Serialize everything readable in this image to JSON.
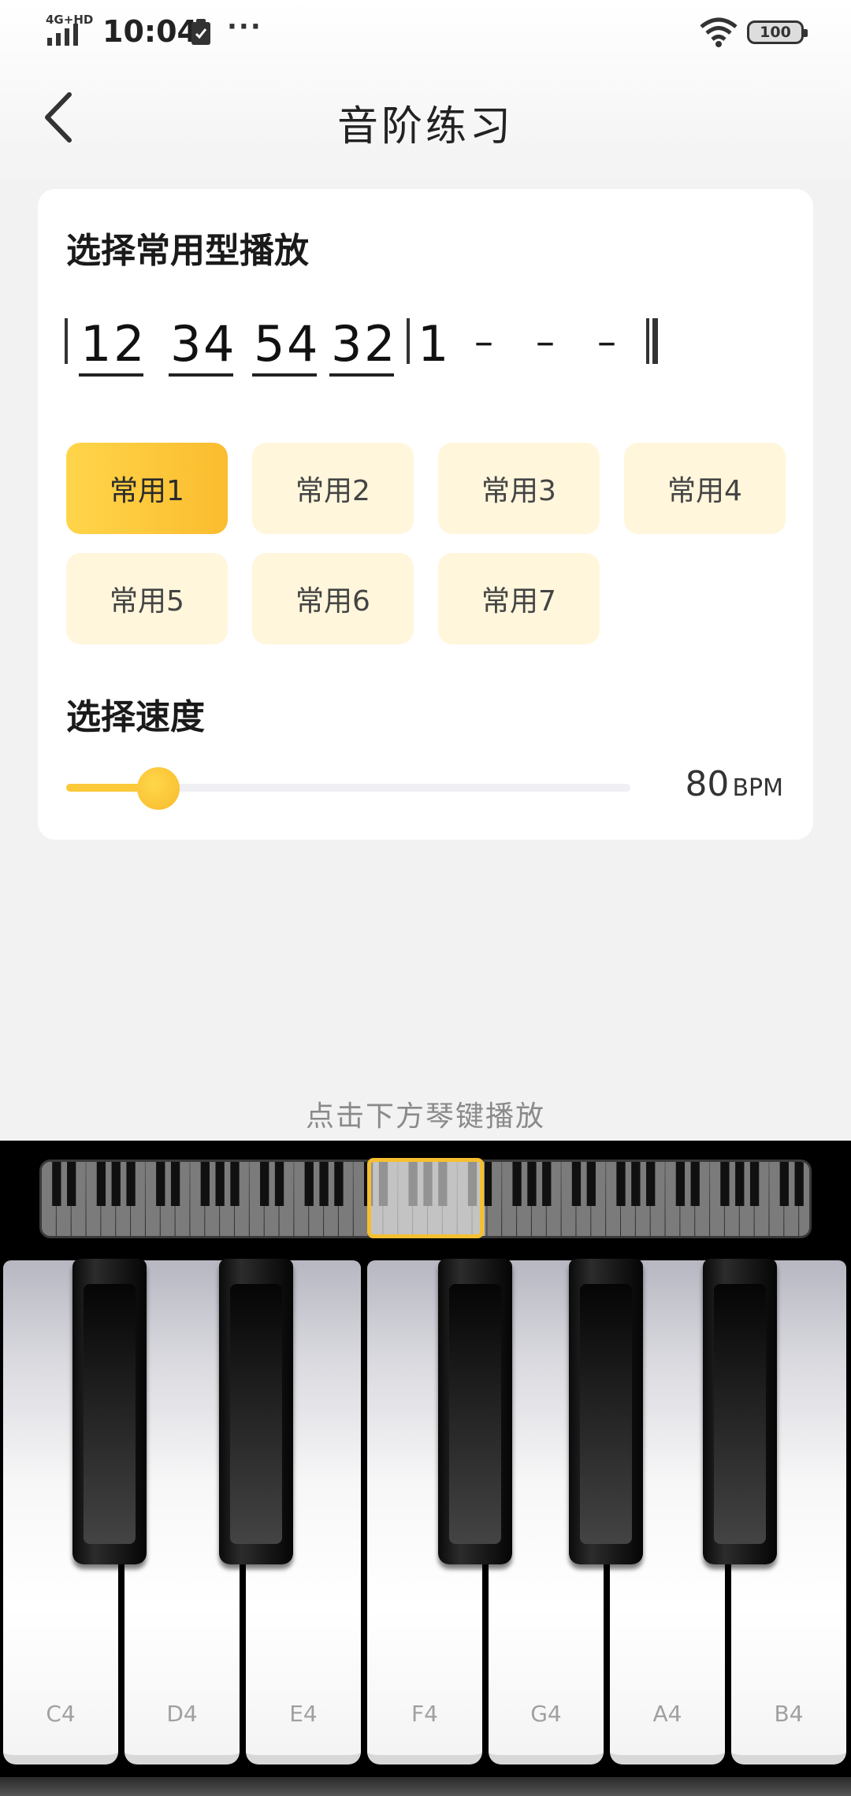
{
  "status_bar": {
    "network": "4G+HD",
    "time": "10:04",
    "more": "···",
    "battery": "100"
  },
  "header": {
    "title": "音阶练习",
    "back_icon": "chevron-left-icon"
  },
  "section_pattern": {
    "title": "选择常用型播放",
    "notation": [
      "1",
      "2",
      "3",
      "4",
      "5",
      "4",
      "3",
      "2",
      "1",
      "–",
      "–",
      "–"
    ],
    "presets": [
      {
        "label": "常用1",
        "active": true
      },
      {
        "label": "常用2",
        "active": false
      },
      {
        "label": "常用3",
        "active": false
      },
      {
        "label": "常用4",
        "active": false
      },
      {
        "label": "常用5",
        "active": false
      },
      {
        "label": "常用6",
        "active": false
      },
      {
        "label": "常用7",
        "active": false
      }
    ]
  },
  "section_speed": {
    "title": "选择速度",
    "bpm_value": "80",
    "bpm_unit": "BPM"
  },
  "hint": "点击下方琴键播放",
  "piano": {
    "white_keys": [
      "C4",
      "D4",
      "E4",
      "F4",
      "G4",
      "A4",
      "B4"
    ]
  },
  "colors": {
    "accent": "#fcc534",
    "preset_bg": "#fff6dc",
    "page_bg": "#f2f2f2"
  }
}
